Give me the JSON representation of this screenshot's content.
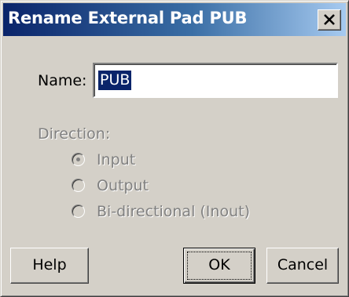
{
  "window": {
    "title": "Rename External Pad PUB"
  },
  "form": {
    "name_label": "Name:",
    "name_value": "PUB",
    "direction_label": "Direction:",
    "direction_options": [
      {
        "label": "Input",
        "selected": true,
        "enabled": false
      },
      {
        "label": "Output",
        "selected": false,
        "enabled": false
      },
      {
        "label": "Bi-directional (Inout)",
        "selected": false,
        "enabled": false
      }
    ]
  },
  "buttons": {
    "help": "Help",
    "ok": "OK",
    "cancel": "Cancel"
  },
  "colors": {
    "title_active": "#0a246a",
    "face": "#d4d0c8",
    "selection": "#0a246a",
    "disabled_text": "#808080"
  },
  "icons": {
    "close": "close-icon",
    "radio": "radio-button-icon"
  }
}
